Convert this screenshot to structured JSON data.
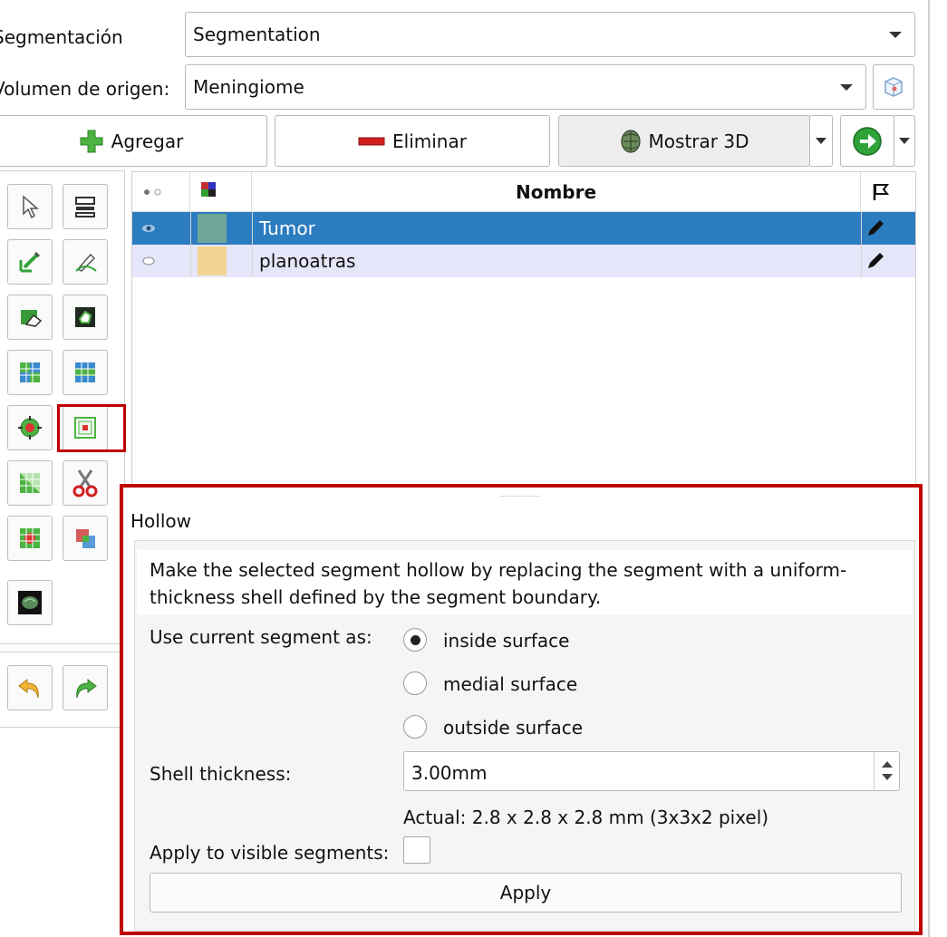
{
  "header": {
    "segmentation_label": "Segmentación",
    "segmentation_value": "Segmentation",
    "source_volume_label": "Volumen de origen:",
    "source_volume_value": "Meningiome"
  },
  "toolbar": {
    "add_label": "Agregar",
    "remove_label": "Eliminar",
    "show3d_label": "Mostrar 3D"
  },
  "table": {
    "columns": [
      "",
      "",
      "Nombre",
      ""
    ],
    "name_header": "Nombre",
    "rows": [
      {
        "name": "Tumor",
        "color": "#6fa79b",
        "visible": true,
        "selected": true
      },
      {
        "name": "planoatras",
        "color": "#f2d595",
        "visible": false,
        "selected": false
      }
    ]
  },
  "effects": [
    "pointer",
    "threshold",
    "paint",
    "draw",
    "erase",
    "level-tracing",
    "grow-from-seeds",
    "fill-between-slices",
    "margin",
    "hollow",
    "smoothing",
    "scissors",
    "islands",
    "logical-operators",
    "mask-volume"
  ],
  "hollow": {
    "title": "Hollow",
    "description_line1": "Make the selected segment hollow by replacing the segment with a uniform-",
    "description_line2": "thickness shell defined by the segment boundary.",
    "use_as_label": "Use current segment as:",
    "options": [
      "inside surface",
      "medial surface",
      "outside surface"
    ],
    "selected_option": "inside surface",
    "thickness_label": "Shell thickness:",
    "thickness_value": "3.00mm",
    "actual_text": "Actual: 2.8 x 2.8 x 2.8 mm (3x3x2 pixel)",
    "apply_visible_label": "Apply to visible segments:",
    "apply_label": "Apply"
  },
  "colors": {
    "selection_blue": "#2c7cc0",
    "row_alt": "#e6e6fa",
    "highlight_red": "#c00000"
  }
}
